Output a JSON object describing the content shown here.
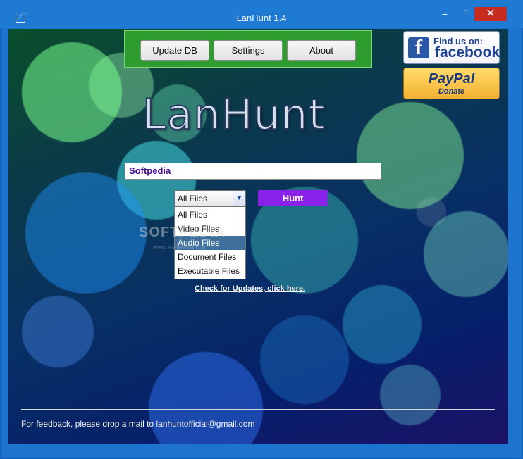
{
  "window": {
    "title": "LanHunt 1.4",
    "app_icon": "app-icon",
    "controls": {
      "minimize": "−",
      "maximize": "☐",
      "close": "✕"
    }
  },
  "toolbar": {
    "update_db": "Update DB",
    "settings": "Settings",
    "about": "About"
  },
  "social": {
    "facebook": {
      "icon_text": "f",
      "line1": "Find us on:",
      "line2": "facebook"
    },
    "paypal": {
      "line1": "PayPal",
      "line2": "Donate"
    }
  },
  "logo": {
    "text": "LanHunt"
  },
  "search": {
    "value": "Softpedia"
  },
  "filter": {
    "selected": "All Files",
    "options": [
      "All Files",
      "Video Files",
      "Audio Files",
      "Document Files",
      "Executable Files"
    ],
    "highlighted": "Audio Files"
  },
  "hunt_button": "Hunt",
  "watermark": {
    "main": "SOFTPEDIA",
    "sub": "www.softpedia.com"
  },
  "updates_link": "Check for Updates, click here.",
  "footer": {
    "feedback": "For feedback, please drop a mail to lanhuntofficial@gmail.com"
  },
  "colors": {
    "title_bar": "#1e7ad3",
    "close_button": "#c72b20",
    "topbar_green": "#2f9c2f",
    "hunt_purple": "#8a21e8",
    "search_text": "#4a0a9a",
    "selected_option": "#3f6f9a"
  }
}
